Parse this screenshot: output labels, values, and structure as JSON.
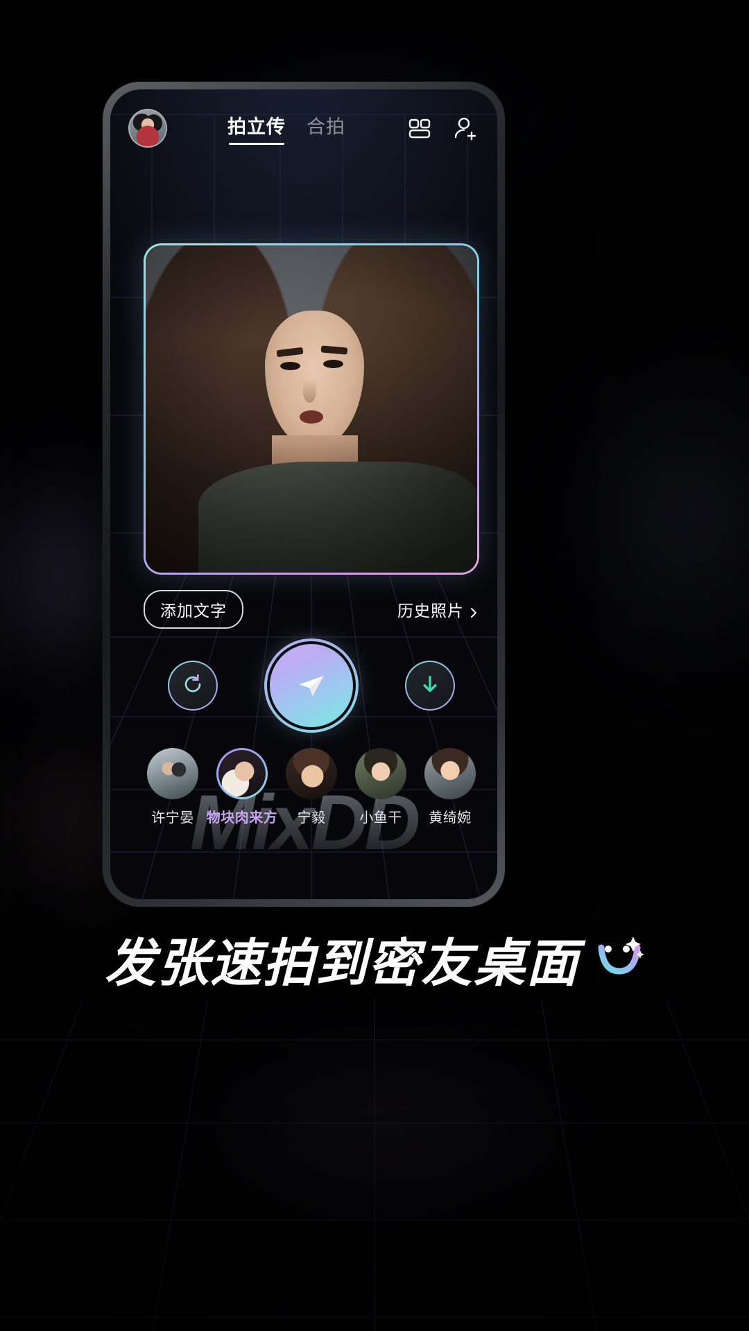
{
  "header": {
    "avatar_name": "user-avatar",
    "tabs": [
      {
        "label": "拍立传",
        "active": true
      },
      {
        "label": "合拍",
        "active": false
      }
    ],
    "icons": [
      {
        "name": "layout-grid-icon"
      },
      {
        "name": "add-person-icon"
      }
    ]
  },
  "photo": {
    "alt": "portrait-preview"
  },
  "controls": {
    "add_text_label": "添加文字",
    "history_label": "历史照片",
    "history_chevron": "chevron-right-icon",
    "refresh_label": "refresh-icon",
    "send_label": "send-icon",
    "download_label": "download-icon"
  },
  "friends": [
    {
      "name": "许宁晏",
      "selected": false,
      "avatar": "a1"
    },
    {
      "name": "物块肉来方",
      "selected": true,
      "avatar": "a2"
    },
    {
      "name": "宁毅",
      "selected": false,
      "avatar": "a3"
    },
    {
      "name": "小鱼干",
      "selected": false,
      "avatar": "a4"
    },
    {
      "name": "黄绮婉",
      "selected": false,
      "avatar": "a5"
    }
  ],
  "watermark": "MixDD",
  "tagline": {
    "text": "发张速拍到密友桌面",
    "face_icon": "winking-face-icon"
  },
  "colors": {
    "accent_cyan": "#8fe6dc",
    "accent_blue": "#8fb6ec",
    "accent_purple": "#c3a3ef",
    "selected_name": "#c8a6f2",
    "tab_active": "#ffffff",
    "tab_idle": "#8d9098",
    "background": "#020203"
  }
}
